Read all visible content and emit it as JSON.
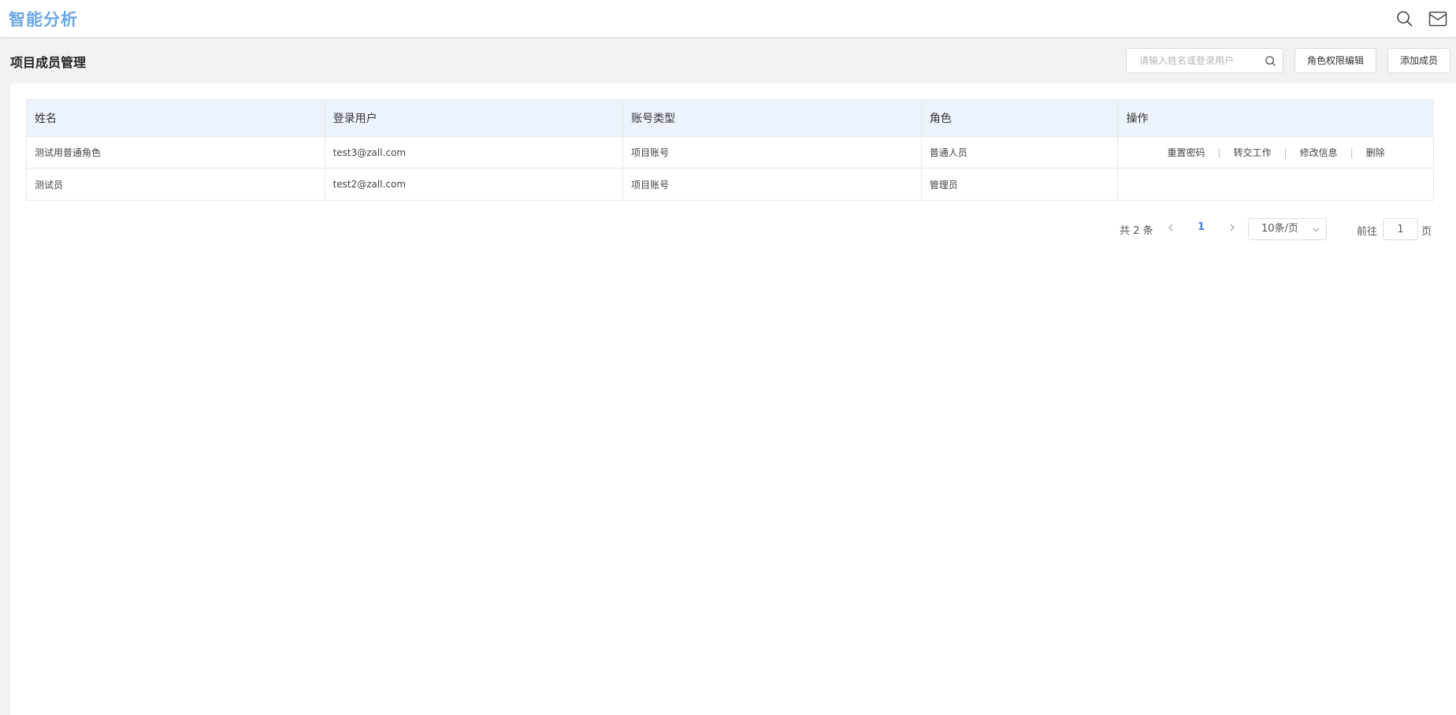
{
  "app": {
    "brand": "智能分析"
  },
  "header_icons": {
    "search": "search-icon",
    "mail": "mail-icon"
  },
  "page": {
    "title": "项目成员管理",
    "search_placeholder": "请输入姓名或登录用户",
    "search_value": "",
    "role_button": "角色权限编辑",
    "add_button": "添加成员"
  },
  "table": {
    "columns": [
      "姓名",
      "登录用户",
      "账号类型",
      "角色",
      "操作"
    ],
    "rows": [
      {
        "name": "测试用普通角色",
        "login": "test3@zall.com",
        "account_type": "项目账号",
        "role": "普通人员",
        "actions": [
          "重置密码",
          "转交工作",
          "修改信息",
          "删除"
        ]
      },
      {
        "name": "测试员",
        "login": "test2@zall.com",
        "account_type": "项目账号",
        "role": "管理员",
        "actions": []
      }
    ],
    "action_separator": "|"
  },
  "pagination": {
    "total_text": "共 2 条",
    "current_page": "1",
    "page_size": "10条/页",
    "goto_label": "前往",
    "goto_value": "1",
    "page_suffix": "页"
  },
  "colors": {
    "brand": "#6aa7e6",
    "header_row_bg": "#ecf3fc",
    "active_page": "#4a86d4"
  }
}
